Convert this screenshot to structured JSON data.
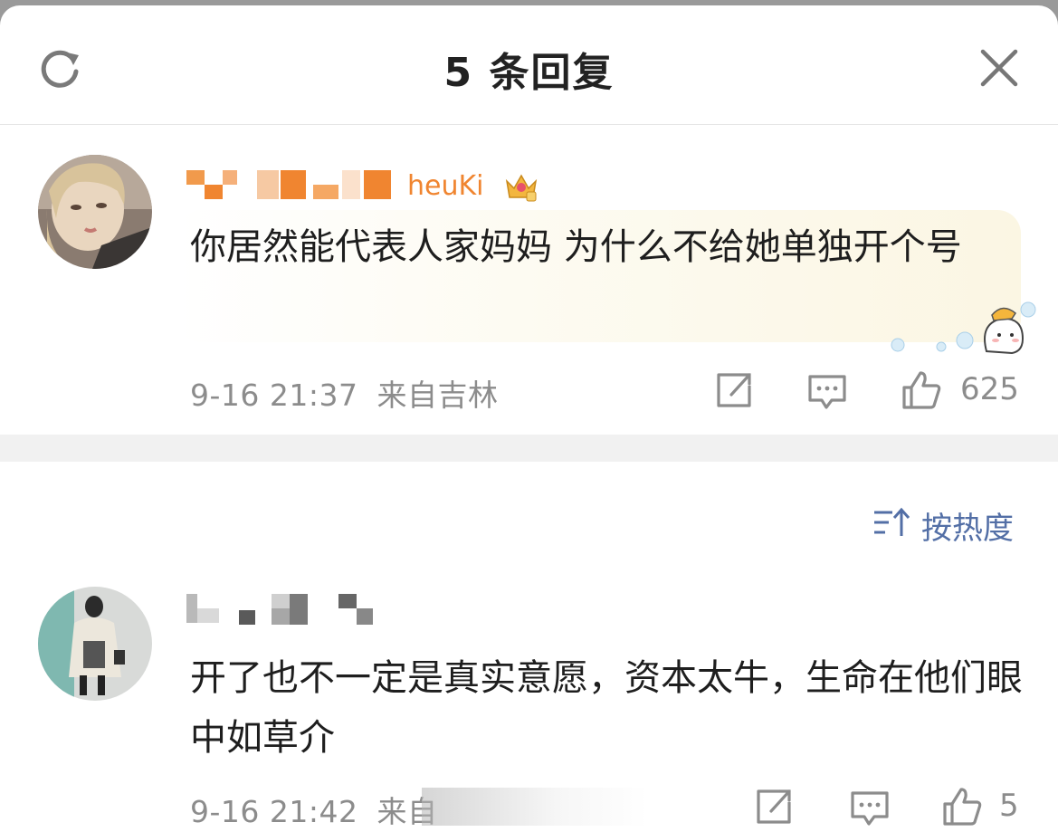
{
  "header": {
    "title": "5 条回复",
    "refresh_icon": "refresh-icon",
    "close_icon": "close-icon"
  },
  "main_comment": {
    "username_visible_fragment": "heuKi",
    "badge_icon": "crown-badge-icon",
    "text": "你居然能代表人家妈妈 为什么不给她单独开个号",
    "timestamp": "9-16 21:37",
    "location": "来自吉林",
    "like_count": "625"
  },
  "sort": {
    "label": "按热度",
    "icon": "sort-icon"
  },
  "reply": {
    "text": "开了也不一定是真实意愿，资本太牛，生命在他们眼中如草介",
    "timestamp": "9-16 21:42",
    "location_visible": "来自",
    "like_count": "5"
  },
  "colors": {
    "accent": "#536fa6",
    "meta_gray": "#8c8c8c",
    "divider": "#f1f1f1",
    "username_orange": "#f08530"
  }
}
